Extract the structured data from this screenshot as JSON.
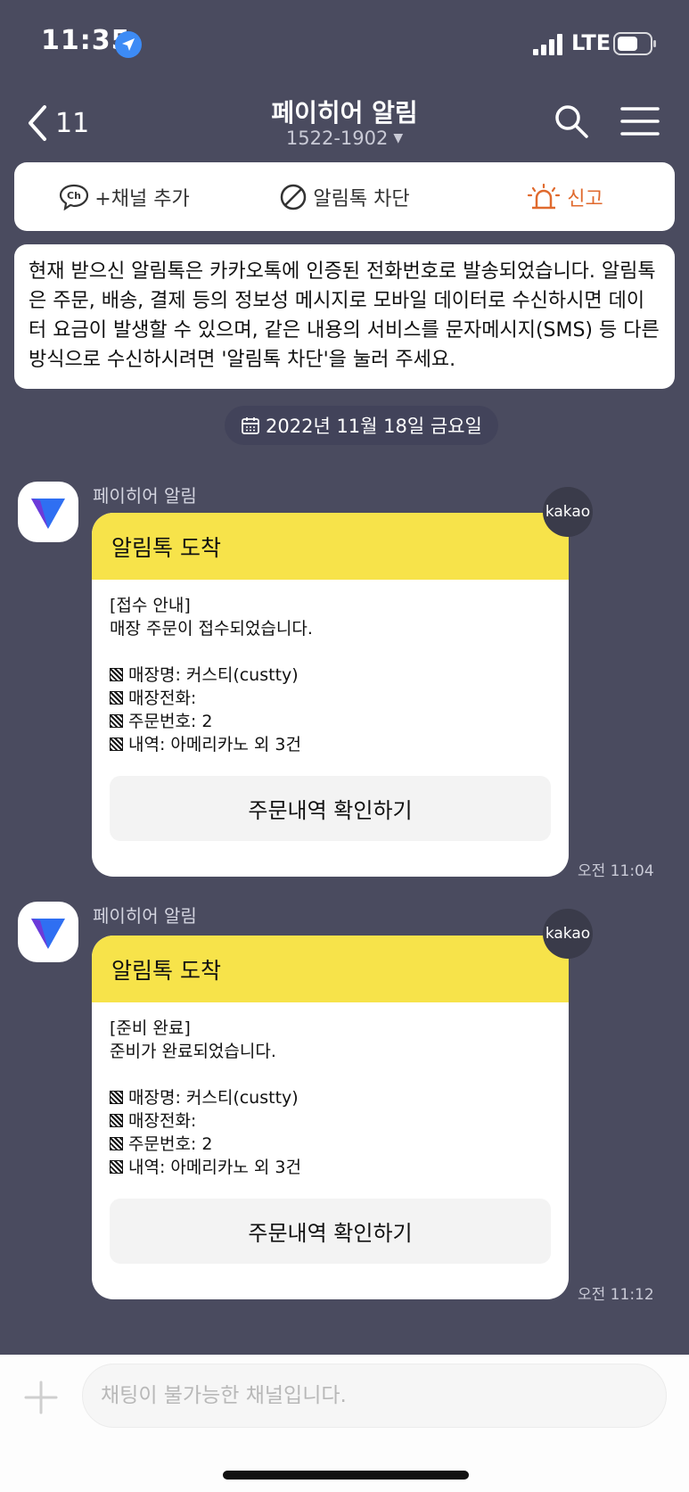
{
  "status_bar": {
    "time": "11:35",
    "network": "LTE"
  },
  "header": {
    "back_count": "11",
    "title": "페이히어 알림",
    "subtitle": "1522-1902"
  },
  "actions": {
    "add_channel": "+채널 추가",
    "block": "알림톡 차단",
    "report": "신고"
  },
  "notice_text": "현재 받으신 알림톡은 카카오톡에 인증된 전화번호로 발송되었습니다. 알림톡은 주문, 배송, 결제 등의 정보성 메시지로 모바일 데이터로 수신하시면 데이터 요금이 발생할 수 있으며, 같은 내용의 서비스를 문자메시지(SMS) 등 다른 방식으로 수신하시려면 '알림톡 차단'을 눌러 주세요.",
  "date_divider": "2022년 11월 18일 금요일",
  "messages": [
    {
      "sender": "페이히어 알림",
      "badge": "kakao",
      "title": "알림톡 도착",
      "heading": "[접수 안내]",
      "line": "매장 주문이 접수되었습니다.",
      "items": [
        "매장명: 커스티(custty)",
        "매장전화:",
        "주문번호: 2",
        "내역: 아메리카노 외 3건"
      ],
      "button": "주문내역 확인하기",
      "time": "오전 11:04"
    },
    {
      "sender": "페이히어 알림",
      "badge": "kakao",
      "title": "알림톡 도착",
      "heading": "[준비 완료]",
      "line": "준비가 완료되었습니다.",
      "items": [
        "매장명: 커스티(custty)",
        "매장전화:",
        "주문번호: 2",
        "내역: 아메리카노 외 3건"
      ],
      "button": "주문내역 확인하기",
      "time": "오전 11:12"
    }
  ],
  "input": {
    "placeholder": "채팅이 불가능한 채널입니다."
  },
  "colors": {
    "background": "#4a4b5f",
    "bubble_header": "#f7e34a",
    "report": "#e06a2e"
  }
}
